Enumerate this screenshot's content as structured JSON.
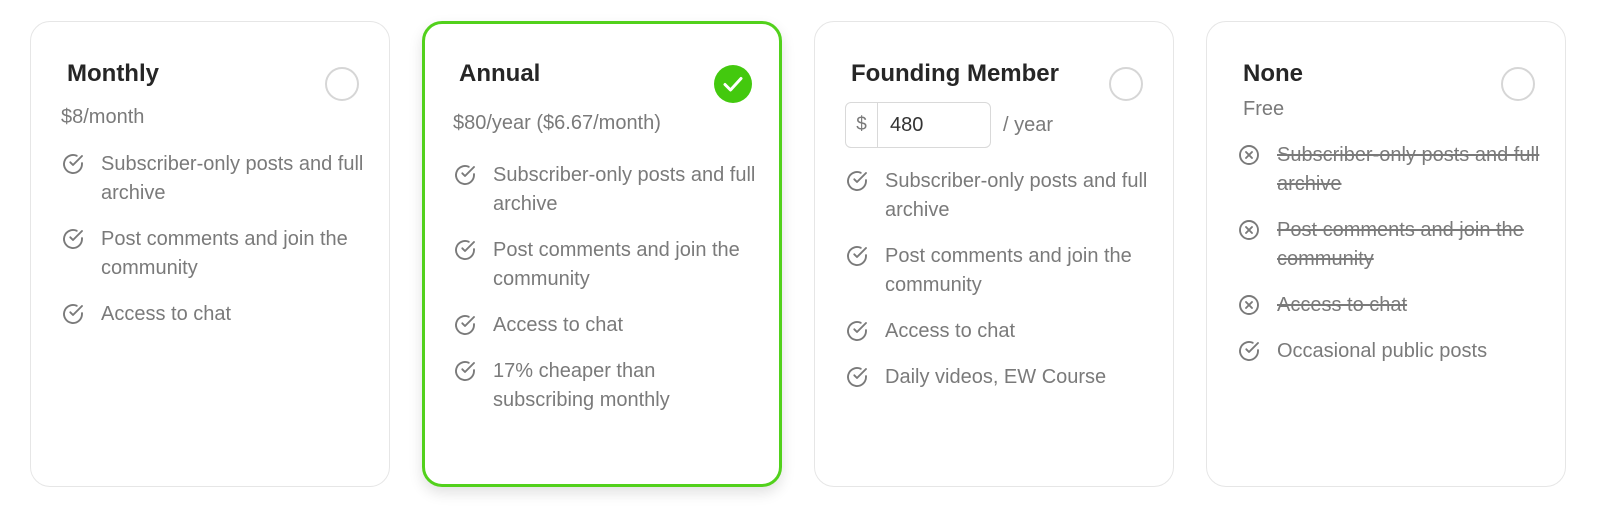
{
  "plans": [
    {
      "title": "Monthly",
      "price": "$8/month",
      "selected": false,
      "features": [
        {
          "text": "Subscriber-only posts and full archive",
          "included": true
        },
        {
          "text": "Post comments and join the community",
          "included": true
        },
        {
          "text": "Access to chat",
          "included": true
        }
      ]
    },
    {
      "title": "Annual",
      "price": "$80/year ($6.67/month)",
      "selected": true,
      "features": [
        {
          "text": "Subscriber-only posts and full archive",
          "included": true
        },
        {
          "text": "Post comments and join the community",
          "included": true
        },
        {
          "text": "Access to chat",
          "included": true
        },
        {
          "text": "17% cheaper than subscribing monthly",
          "included": true
        }
      ]
    },
    {
      "title": "Founding Member",
      "currency_symbol": "$",
      "amount": "480",
      "period": "/ year",
      "selected": false,
      "features": [
        {
          "text": "Subscriber-only posts and full archive",
          "included": true
        },
        {
          "text": "Post comments and join the community",
          "included": true
        },
        {
          "text": "Access to chat",
          "included": true
        },
        {
          "text": "Daily videos, EW Course",
          "included": true
        }
      ]
    },
    {
      "title": "None",
      "price": "Free",
      "selected": false,
      "features": [
        {
          "text": "Subscriber-only posts and full archive",
          "included": false
        },
        {
          "text": "Post comments and join the community",
          "included": false
        },
        {
          "text": "Access to chat",
          "included": false
        },
        {
          "text": "Occasional public posts",
          "included": true
        }
      ]
    }
  ],
  "icons": {
    "included": "check-circle-icon",
    "excluded": "x-circle-icon",
    "selected": "checkmark-icon"
  },
  "colors": {
    "accent": "#52d11c",
    "text_muted": "#7a7a7a",
    "title": "#262626",
    "border": "#e6e6e6"
  }
}
